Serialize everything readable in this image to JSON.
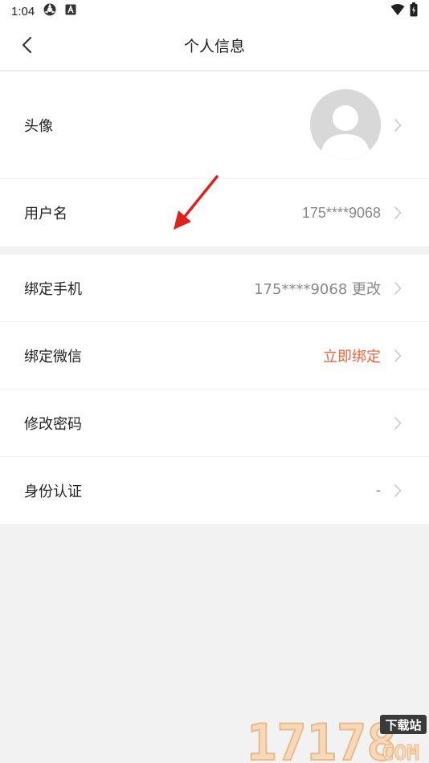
{
  "status_bar": {
    "time": "1:04"
  },
  "header": {
    "title": "个人信息"
  },
  "rows": {
    "avatar": {
      "label": "头像"
    },
    "username": {
      "label": "用户名",
      "value": "175****9068"
    },
    "phone": {
      "label": "绑定手机",
      "value": "175****9068 更改"
    },
    "wechat": {
      "label": "绑定微信",
      "value": "立即绑定"
    },
    "password": {
      "label": "修改密码"
    },
    "identity": {
      "label": "身份认证",
      "value": "-"
    }
  },
  "watermark": {
    "number": "17178",
    "badge": "下载站",
    "suffix": "COM"
  },
  "colors": {
    "accent": "#f0643c",
    "background": "#f2f2f2",
    "annotation": "#e0201a"
  },
  "icons": [
    "back-arrow",
    "wifi",
    "battery",
    "chevron-right",
    "default-avatar"
  ]
}
